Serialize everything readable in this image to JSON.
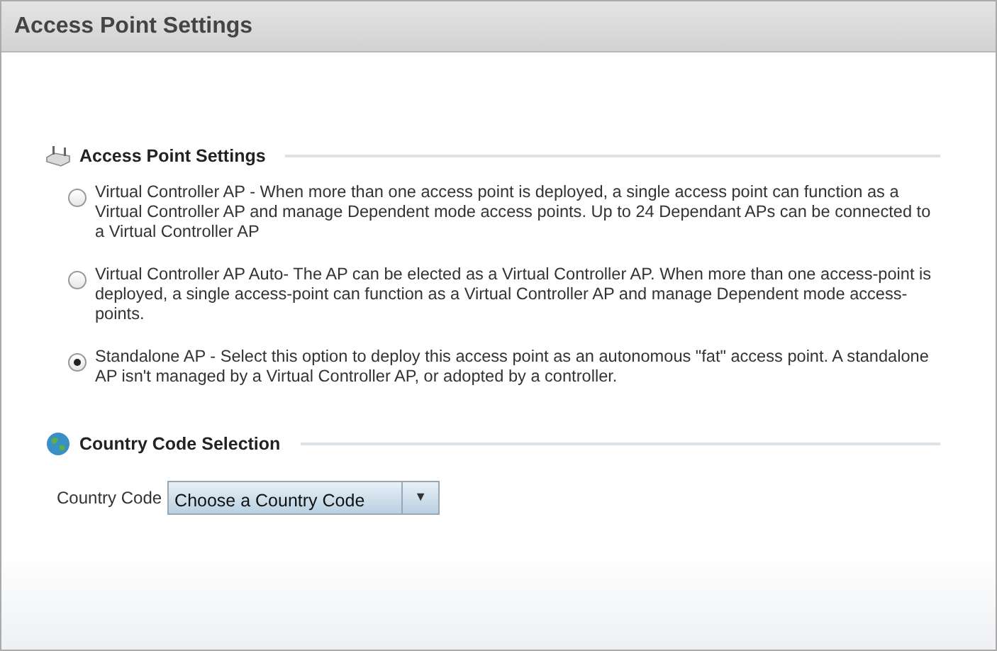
{
  "window": {
    "title": "Access Point Settings"
  },
  "sections": [
    {
      "kind": "radio",
      "title": "Access Point Settings",
      "options": [
        {
          "label": "Virtual Controller AP - When more than one access point is deployed, a single access point can function as a Virtual Controller AP and manage Dependent mode access points. Up to 24 Dependant APs can be connected to a Virtual Controller AP",
          "selected": false
        },
        {
          "label": "Virtual Controller AP Auto- The AP can be elected as a Virtual Controller AP.  When more than one access-point is deployed, a single access-point can function as a Virtual Controller AP and manage Dependent mode access-points.",
          "selected": false
        },
        {
          "label": "Standalone AP - Select this option to deploy this access point as an autonomous \"fat\" access point. A standalone AP isn't managed by a Virtual Controller AP, or adopted by a controller.",
          "selected": true
        }
      ]
    },
    {
      "kind": "select",
      "title": "Country Code Selection",
      "label": "Country Code",
      "value": "Choose a Country Code",
      "caret": "▼"
    }
  ]
}
